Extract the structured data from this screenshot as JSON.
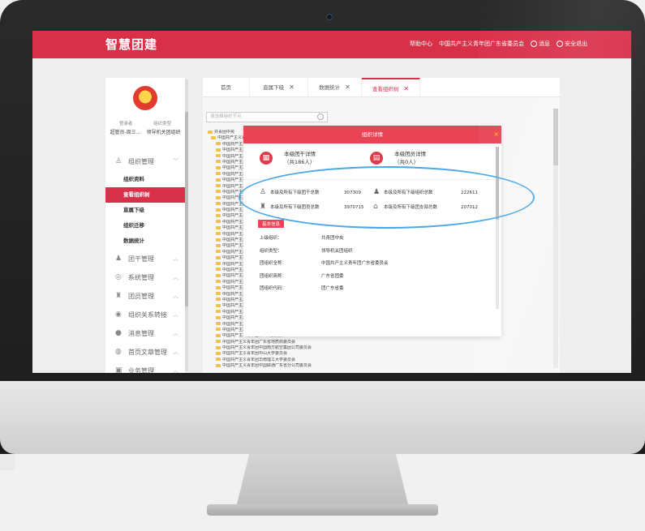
{
  "app": {
    "title": "智慧团建"
  },
  "topnav": {
    "help": "帮助中心",
    "org": "中国共产主义青年团广东省委员会",
    "messages": "消息",
    "logout": "安全退出"
  },
  "sidebar": {
    "user_labels": [
      "登录者",
      "组织类型"
    ],
    "user_values": [
      "超管员-周三...",
      "领导机关团组织"
    ],
    "groups": [
      {
        "label": "组织管理",
        "icon": "org-icon",
        "caret": "﹀"
      },
      {
        "label": "团干管理",
        "icon": "cadre-icon",
        "caret": "︿"
      },
      {
        "label": "系统管理",
        "icon": "system-icon",
        "caret": "︿"
      },
      {
        "label": "团员管理",
        "icon": "member-icon",
        "caret": "︿"
      },
      {
        "label": "组织关系转接",
        "icon": "transfer-icon",
        "caret": "︿"
      },
      {
        "label": "消息管理",
        "icon": "message-icon",
        "caret": "︿"
      },
      {
        "label": "首页文章管理",
        "icon": "article-icon",
        "caret": "︿"
      },
      {
        "label": "业务管理",
        "icon": "business-icon",
        "caret": "︿"
      }
    ],
    "items": [
      "组织资料",
      "查看组织树",
      "直属下级",
      "组织迁移",
      "数据统计"
    ]
  },
  "tabs": [
    {
      "label": "首页"
    },
    {
      "label": "直属下级",
      "close": "✕"
    },
    {
      "label": "数据统计",
      "close": "✕"
    },
    {
      "label": "查看组织树",
      "close": "✕"
    }
  ],
  "search": {
    "placeholder": "请选择组织节点"
  },
  "tree": {
    "root": "共青团中央",
    "province": "中国共产主义青年团广东省委员会",
    "child_prefix": "中国共产主义青年团",
    "bottom_rows": [
      "中国共产主义青年团中山市委员会",
      "中国共产主义青年团广东省地质局委员会",
      "中国共产主义青年团中国南方航空集团公司委员会",
      "中国共产主义青年团中山大学委员会",
      "中国共产主义青年团华南理工大学委员会",
      "中国共产主义青年团中国联通广东省分公司委员会"
    ]
  },
  "modal": {
    "title": "组织详情",
    "close": "×",
    "cadre_summary": {
      "line1": "本级团干详情",
      "line2": "（共186人）"
    },
    "member_summary": {
      "line1": "本级团员详情",
      "line2": "（共0人）"
    },
    "stats": [
      {
        "label": "本级及所有下级团干总数",
        "value": "307309"
      },
      {
        "label": "本级及所有下级组织总数",
        "value": "222611"
      },
      {
        "label": "本级及所有下级团员总数",
        "value": "3970715"
      },
      {
        "label": "本级及所有下级团支部总数",
        "value": "207012"
      }
    ],
    "basic_tag": "基本信息",
    "info": [
      {
        "k": "上级组织：",
        "v": "共青团中央"
      },
      {
        "k": "组织类型：",
        "v": "领导机关团组织"
      },
      {
        "k": "团组织全称：",
        "v": "中国共产主义青年团广东省委员会"
      },
      {
        "k": "团组织简称：",
        "v": "广东省团委"
      },
      {
        "k": "团组织代码：",
        "v": "团广东省委"
      }
    ]
  }
}
